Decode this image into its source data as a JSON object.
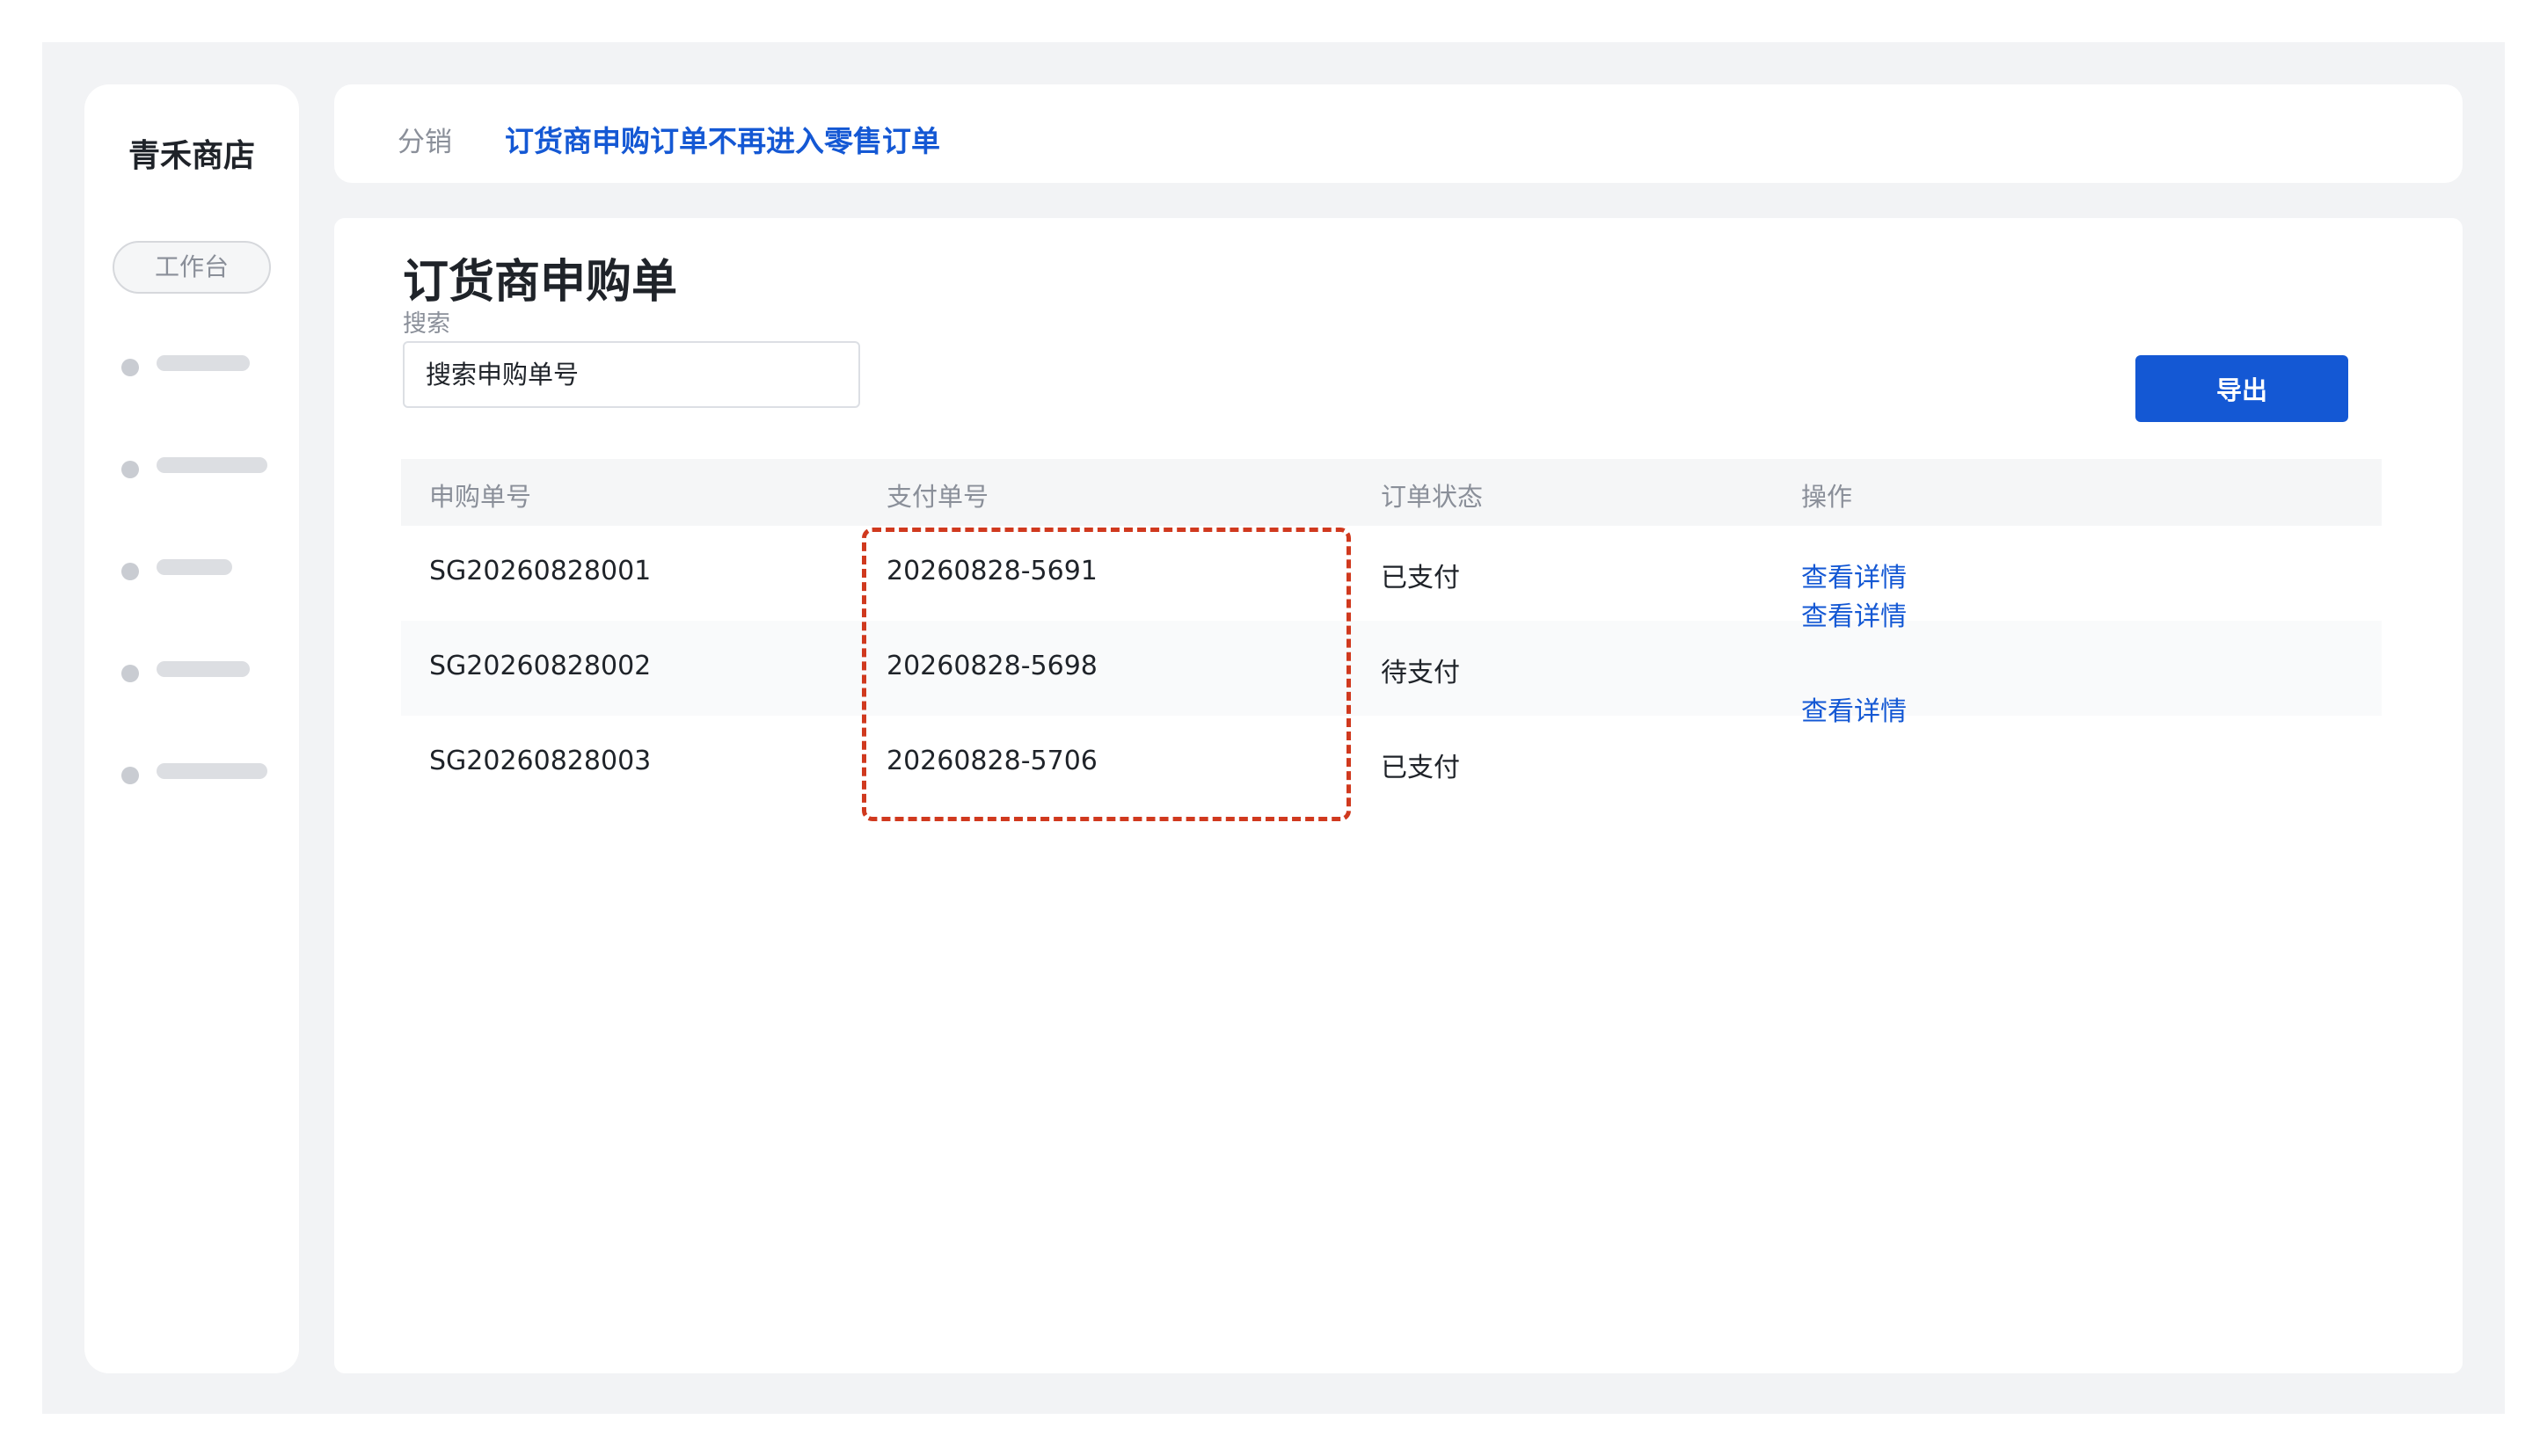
{
  "sidebar": {
    "brand": "青禾商店",
    "workspace_label": "工作台",
    "nav_items": [
      {
        "icon": "nav-dot"
      },
      {
        "icon": "nav-dot"
      },
      {
        "icon": "nav-dot"
      },
      {
        "icon": "nav-dot"
      },
      {
        "icon": "nav-dot"
      }
    ]
  },
  "breadcrumb": {
    "section": "分销",
    "current": "订货商申购订单不再进入零售订单"
  },
  "page": {
    "title": "订货商申购单",
    "search_label": "搜索",
    "search_placeholder": "搜索申购单号",
    "export_label": "导出"
  },
  "table": {
    "headers": [
      "申购单号",
      "支付单号",
      "订单状态",
      "操作"
    ],
    "rows": [
      {
        "order_no": "SG20260828001",
        "payment_no": "20260828-5691",
        "status": "已支付"
      },
      {
        "order_no": "SG20260828002",
        "payment_no": "20260828-5698",
        "status": "待支付"
      },
      {
        "order_no": "SG20260828003",
        "payment_no": "20260828-5706",
        "status": "已支付"
      }
    ],
    "action_links": [
      "查看详情",
      "查看详情",
      "查看详情"
    ]
  },
  "colors": {
    "accent": "#1458d4",
    "highlight_dash": "#d0391e",
    "background": "#f2f3f5"
  }
}
